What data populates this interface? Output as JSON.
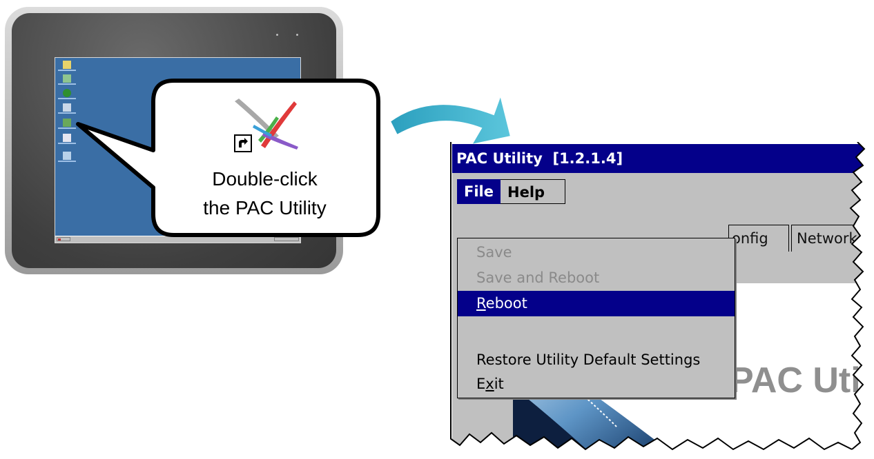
{
  "callout": {
    "line1": "Double-click",
    "line2": "the PAC Utility"
  },
  "window": {
    "title": "PAC Utility  [1.2.1.4]"
  },
  "menubar": {
    "file": "File",
    "help": "Help"
  },
  "file_menu": {
    "items": [
      {
        "label": "Save",
        "state": "disabled"
      },
      {
        "label": "Save and Reboot",
        "state": "disabled"
      },
      {
        "label": "Reboot",
        "state": "selected",
        "mnemonic": "R"
      },
      {
        "label": "Restore Utility Default Settings",
        "state": "enabled"
      },
      {
        "label": "Exit",
        "state": "enabled",
        "mnemonic": "x"
      }
    ]
  },
  "tabs": {
    "config_partial": "onfig",
    "network": "Network"
  },
  "splash": {
    "pac_util_partial": "PAC Util"
  },
  "icons": {
    "pac_utility": "pac-utility-icon",
    "shortcut": "shortcut-arrow-icon",
    "arrow": "curved-arrow-icon"
  },
  "colors": {
    "titlebar": "#04008a",
    "selection": "#04008a",
    "menu_bg": "#c0c0c0",
    "desktop": "#3a6ea5",
    "arrow": "#3fb3cc"
  }
}
